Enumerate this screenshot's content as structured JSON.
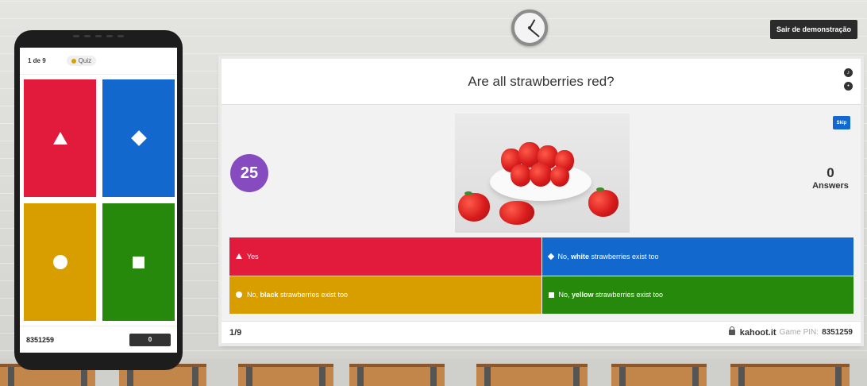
{
  "exit_demo_label": "Sair de demonstração",
  "phone": {
    "counter": "1 de 9",
    "chip_label": "Quiz",
    "pin": "8351259",
    "score": "0"
  },
  "question": "Are all strawberries red?",
  "timer": "25",
  "skip_label": "Skip",
  "answers_count": "0",
  "answers_label": "Answers",
  "answer_options": [
    {
      "color": "#e21b3c",
      "shape": "triangle",
      "parts": [
        "Yes"
      ]
    },
    {
      "color": "#1368ce",
      "shape": "diamond",
      "parts": [
        "No, ",
        "white",
        " strawberries exist too"
      ]
    },
    {
      "color": "#d89e00",
      "shape": "circle",
      "parts": [
        "No, ",
        "black",
        " strawberries exist too"
      ]
    },
    {
      "color": "#26890c",
      "shape": "square",
      "parts": [
        "No, ",
        "yellow",
        " strawberries exist too"
      ]
    }
  ],
  "progress": "1/9",
  "kahoot_url": "kahoot.it",
  "pin_label": "Game PIN:",
  "pin_value": "8351259",
  "colors": {
    "red": "#e21b3c",
    "blue": "#1368ce",
    "yellow": "#d89e00",
    "green": "#26890c",
    "timer": "#864cbf"
  }
}
